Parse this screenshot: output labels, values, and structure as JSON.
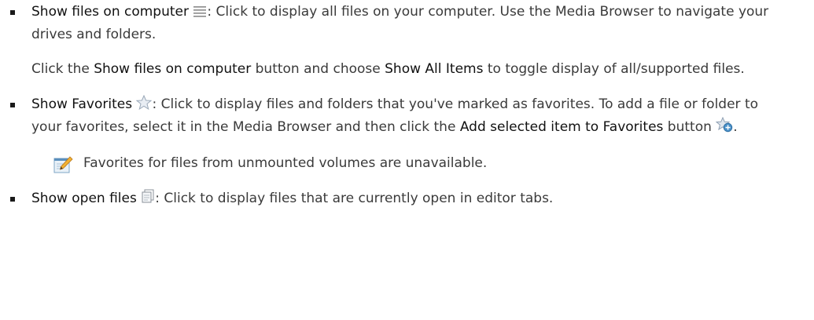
{
  "items": [
    {
      "label": "Show files on computer",
      "icon": "list-icon",
      "text": ": Click to display all files on your computer. Use the Media Browser to navigate your drives and folders.",
      "sub": {
        "t1": "Click the ",
        "b1": "Show files on computer",
        "t2": " button and choose ",
        "b2": "Show All Items",
        "t3": " to toggle display of all/supported files."
      }
    },
    {
      "label": "Show Favorites",
      "icon": "star-icon",
      "text": ": Click to display files and folders that you've marked as favorites. To add a file or folder to your favorites, select it in the Media Browser and then click the ",
      "bold2": "Add selected item to Favorites",
      "text2": " button",
      "icon2": "add-favorite-icon",
      "tail": "."
    },
    {
      "label": "Show open files",
      "icon": "open-files-icon",
      "text": ": Click to display files that are currently open in editor tabs."
    }
  ],
  "note": {
    "icon": "note-icon",
    "text": "Favorites for files from unmounted volumes are unavailable."
  }
}
